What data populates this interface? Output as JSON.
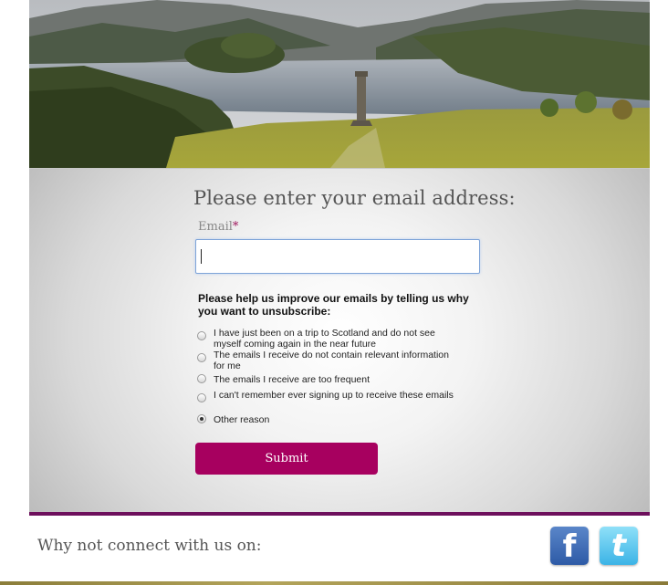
{
  "hero": {
    "image_name": "scottish-loch-landscape"
  },
  "form": {
    "title": "Please enter your email address:",
    "email_label": "Email",
    "required_marker": "*",
    "email_value": "",
    "question": "Please help us improve our emails by telling us why you want to unsubscribe:",
    "options": [
      {
        "label": "I have just been on a trip to Scotland and do not see myself coming again in the near future",
        "checked": false
      },
      {
        "label": "The emails I receive do not contain relevant information for me",
        "checked": false
      },
      {
        "label": "The emails I receive are too frequent",
        "checked": false
      },
      {
        "label": "I can't remember ever signing up to receive these emails",
        "checked": false
      },
      {
        "label": "Other reason",
        "checked": true
      }
    ],
    "submit_label": "Submit"
  },
  "footer": {
    "connect_text": "Why not connect with us on:",
    "social": [
      {
        "name": "facebook-icon",
        "glyph": "f"
      },
      {
        "name": "twitter-icon",
        "glyph": "t"
      }
    ]
  },
  "colors": {
    "accent": "#a7005f",
    "rule": "#6d0f5c",
    "input_border": "#7ea4d8"
  }
}
